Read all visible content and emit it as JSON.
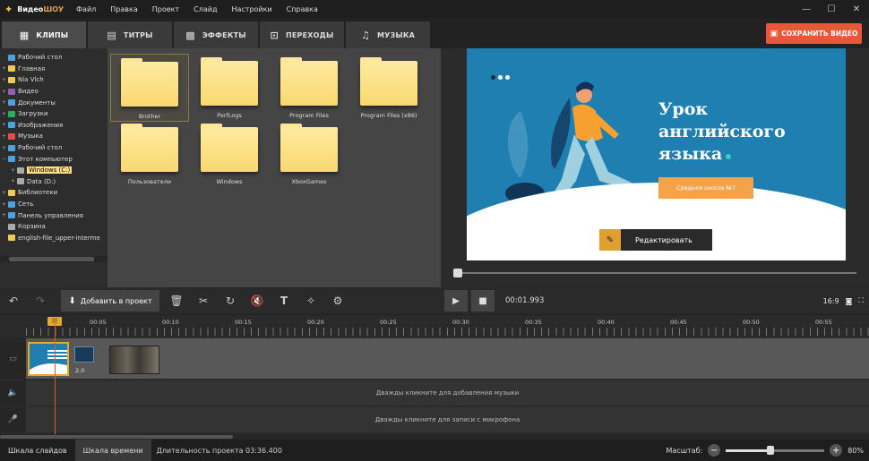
{
  "menubar": {
    "logo_main": "Видео",
    "logo_accent": "ШОУ",
    "items": [
      "Файл",
      "Правка",
      "Проект",
      "Слайд",
      "Настройки",
      "Справка"
    ]
  },
  "tabs": [
    {
      "label": "КЛИПЫ",
      "icon": "clips-icon",
      "glyph": "▦"
    },
    {
      "label": "ТИТРЫ",
      "icon": "titles-icon",
      "glyph": "▤"
    },
    {
      "label": "ЭФФЕКТЫ",
      "icon": "effects-icon",
      "glyph": "▩"
    },
    {
      "label": "ПЕРЕХОДЫ",
      "icon": "transitions-icon",
      "glyph": "⊡"
    },
    {
      "label": "МУЗЫКА",
      "icon": "music-icon",
      "glyph": "♫"
    }
  ],
  "save_button": "СОХРАНИТЬ ВИДЕО",
  "tree": [
    {
      "label": "Рабочий стол",
      "exp": "",
      "color": "#4aa3df"
    },
    {
      "label": "Главная",
      "exp": "+",
      "color": "#f2c94c"
    },
    {
      "label": "Nia Vlch",
      "exp": "+",
      "color": "#f2c94c"
    },
    {
      "label": "Видео",
      "exp": "+",
      "color": "#9b59b6"
    },
    {
      "label": "Документы",
      "exp": "+",
      "color": "#4aa3df"
    },
    {
      "label": "Загрузки",
      "exp": "+",
      "color": "#27ae60"
    },
    {
      "label": "Изображения",
      "exp": "+",
      "color": "#4aa3df"
    },
    {
      "label": "Музыка",
      "exp": "+",
      "color": "#e74c3c"
    },
    {
      "label": "Рабочий стол",
      "exp": "+",
      "color": "#4aa3df"
    },
    {
      "label": "Этот компьютер",
      "exp": "−",
      "color": "#4aa3df"
    },
    {
      "label": "Windows (C:)",
      "exp": "+",
      "color": "#aaaaaa",
      "selected": true,
      "indent": true
    },
    {
      "label": "Data (D:)",
      "exp": "+",
      "color": "#aaaaaa",
      "indent": true
    },
    {
      "label": "Библиотеки",
      "exp": "+",
      "color": "#f2c94c"
    },
    {
      "label": "Сеть",
      "exp": "+",
      "color": "#4aa3df"
    },
    {
      "label": "Панель управления",
      "exp": "+",
      "color": "#4aa3df"
    },
    {
      "label": "Корзина",
      "exp": "",
      "color": "#aaaaaa"
    },
    {
      "label": "english-file_upper-interme",
      "exp": "",
      "color": "#f2c94c"
    }
  ],
  "folders": [
    {
      "name": "Brother",
      "selected": true
    },
    {
      "name": "PerfLogs"
    },
    {
      "name": "Program Files"
    },
    {
      "name": "Program Files (x86)"
    },
    {
      "name": "Пользователи"
    },
    {
      "name": "Windows"
    },
    {
      "name": "XboxGames"
    }
  ],
  "slide": {
    "title_l1": "Урок",
    "title_l2": "английского",
    "title_l3": "языка",
    "subtitle": "Средняя школа №7",
    "edit_label": "Редактировать"
  },
  "toolbar": {
    "undo": "undo-icon",
    "redo": "redo-icon",
    "add_label": "Добавить в проект"
  },
  "player": {
    "time": "00:01.993",
    "ratio": "16:9"
  },
  "ruler": [
    "00:05",
    "00:10",
    "00:15",
    "00:20",
    "00:25",
    "00:30",
    "00:35",
    "00:40",
    "00:45",
    "00:50",
    "00:55"
  ],
  "timeline": {
    "transition_duration": "2.0",
    "music_hint": "Дважды кликните для добавления музыки",
    "mic_hint": "Дважды кликните для записи с микрофона"
  },
  "status": {
    "tab_slides": "Шкала слайдов",
    "tab_timeline": "Шкала времени",
    "duration": "Длительность проекта 03:36.400",
    "zoom_label": "Масштаб:",
    "zoom_value": "80%",
    "zoom_level": 0.45
  }
}
